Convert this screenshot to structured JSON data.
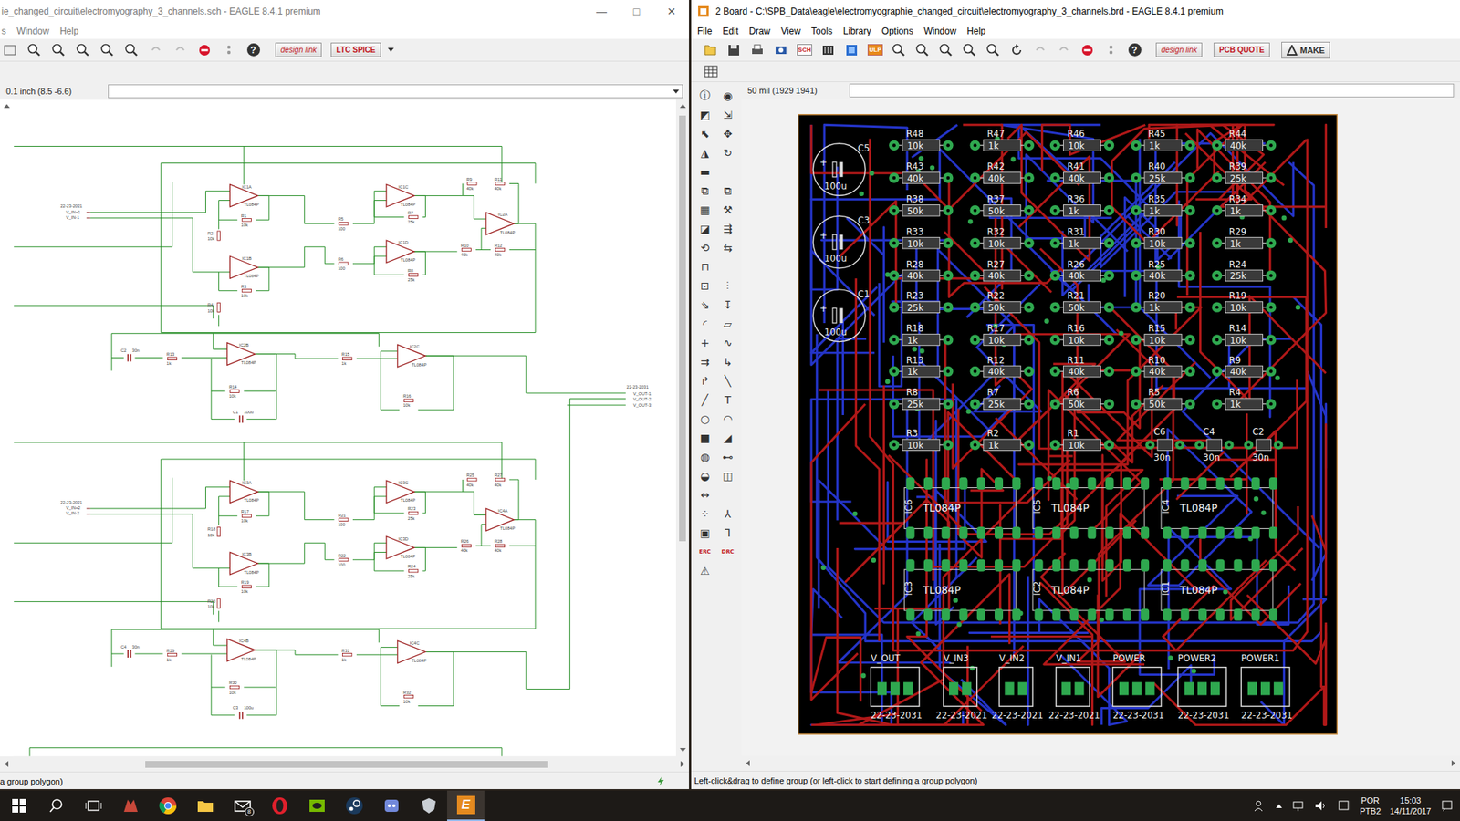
{
  "schematic_window": {
    "title": "ie_changed_circuit\\electromyography_3_channels.sch - EAGLE 8.4.1 premium",
    "controls": [
      "—",
      "□",
      "✕"
    ],
    "menu": [
      "s",
      "Window",
      "Help"
    ],
    "help_icon": "?",
    "badges": [
      "design link",
      "LTC SPICE"
    ],
    "coordinate": "0.1 inch (8.5 -6.6)",
    "status": "a group polygon)",
    "channels": [
      {
        "connector": "22-23-2021",
        "inputs": [
          "V_IN+1",
          "V_IN-1"
        ],
        "opamps": [
          {
            "name": "IC1A",
            "value": "TL084P"
          },
          {
            "name": "IC1C",
            "value": "TL084P"
          },
          {
            "name": "IC2A",
            "value": "TL084P"
          },
          {
            "name": "IC1B",
            "value": "TL084P"
          },
          {
            "name": "IC1D",
            "value": "TL084P"
          },
          {
            "name": "IC2B",
            "value": "TL084P"
          },
          {
            "name": "IC2C",
            "value": "TL084P"
          }
        ],
        "resistors": [
          {
            "name": "R1",
            "value": "10k"
          },
          {
            "name": "R2",
            "value": "10k"
          },
          {
            "name": "R3",
            "value": "10k"
          },
          {
            "name": "R4",
            "value": "10k"
          },
          {
            "name": "R5",
            "value": "100"
          },
          {
            "name": "R6",
            "value": "100"
          },
          {
            "name": "R7",
            "value": "25k"
          },
          {
            "name": "R8",
            "value": "25k"
          },
          {
            "name": "R9",
            "value": "40k"
          },
          {
            "name": "R10",
            "value": "40k"
          },
          {
            "name": "R11",
            "value": "40k"
          },
          {
            "name": "R12",
            "value": "40k"
          },
          {
            "name": "R13",
            "value": "1k"
          },
          {
            "name": "R14",
            "value": "10k"
          },
          {
            "name": "R15",
            "value": "1k"
          },
          {
            "name": "R16",
            "value": "10k"
          }
        ],
        "capacitors": [
          {
            "name": "C2",
            "value": "30n"
          },
          {
            "name": "C1",
            "value": "100u"
          }
        ]
      },
      {
        "connector": "22-23-2021",
        "inputs": [
          "V_IN+2",
          "V_IN-2"
        ],
        "opamps": [
          {
            "name": "IC3A",
            "value": "TL084P"
          },
          {
            "name": "IC3C",
            "value": "TL084P"
          },
          {
            "name": "IC4A",
            "value": "TL084P"
          },
          {
            "name": "IC3B",
            "value": "TL084P"
          },
          {
            "name": "IC3D",
            "value": "TL084P"
          },
          {
            "name": "IC4B",
            "value": "TL084P"
          },
          {
            "name": "IC4C",
            "value": "TL084P"
          }
        ],
        "resistors": [
          {
            "name": "R17",
            "value": "10k"
          },
          {
            "name": "R18",
            "value": "10k"
          },
          {
            "name": "R19",
            "value": "10k"
          },
          {
            "name": "R20",
            "value": "10k"
          },
          {
            "name": "R21",
            "value": "100"
          },
          {
            "name": "R22",
            "value": "100"
          },
          {
            "name": "R23",
            "value": "25k"
          },
          {
            "name": "R24",
            "value": "25k"
          },
          {
            "name": "R25",
            "value": "40k"
          },
          {
            "name": "R26",
            "value": "40k"
          },
          {
            "name": "R27",
            "value": "40k"
          },
          {
            "name": "R28",
            "value": "40k"
          },
          {
            "name": "R29",
            "value": "1k"
          },
          {
            "name": "R30",
            "value": "10k"
          },
          {
            "name": "R31",
            "value": "1k"
          },
          {
            "name": "R32",
            "value": "10k"
          }
        ],
        "capacitors": [
          {
            "name": "C4",
            "value": "30n"
          },
          {
            "name": "C3",
            "value": "100u"
          }
        ]
      }
    ],
    "output": {
      "part": "22-23-2031",
      "pins": [
        "V_OUT-1",
        "V_OUT-2",
        "V_OUT-3"
      ]
    }
  },
  "board_window": {
    "title": "2 Board - C:\\SPB_Data\\eagle\\electromyographie_changed_circuit\\electromyography_3_channels.brd - EAGLE 8.4.1 premium",
    "menu": [
      "File",
      "Edit",
      "Draw",
      "View",
      "Tools",
      "Library",
      "Options",
      "Window",
      "Help"
    ],
    "help_icon": "?",
    "icon_texts": [
      "SCH",
      "ULP"
    ],
    "badges": [
      "design link",
      "PCB QUOTE",
      "MAKE"
    ],
    "coordinate": "50 mil (1929 1941)",
    "status": "Left-click&drag to define group (or left-click to start defining a group polygon)",
    "tools": [
      [
        "ⓘ",
        "◉"
      ],
      [
        "◩",
        "⇲"
      ],
      [
        "⬉",
        "✥"
      ],
      [
        "◮",
        "↻"
      ],
      [
        "▬"
      ],
      [
        "⧉",
        "⧉"
      ],
      [
        "▦",
        "⚒"
      ],
      [
        "◪",
        "⇶"
      ],
      [
        "⟲",
        "⇆"
      ],
      [
        "⊓"
      ],
      [
        "⊡",
        "⫶"
      ],
      [
        "⇘",
        "↧"
      ],
      [
        "◜",
        "▱"
      ],
      [
        "+",
        "∿"
      ],
      [
        "⇉",
        "↳"
      ],
      [
        "↱",
        "╲"
      ],
      [
        "╱",
        "T"
      ],
      [
        "○",
        "◠"
      ],
      [
        "■",
        "◢"
      ],
      [
        "◍",
        "⊷"
      ],
      [
        "◒",
        "◫"
      ],
      [
        "↔"
      ],
      [
        "⁘",
        "⅄"
      ],
      [
        "▣",
        "⅂"
      ],
      [
        "ERC",
        "DRC"
      ],
      [
        "⚠"
      ]
    ],
    "resistor_rows": [
      [
        {
          "name": "R48",
          "value": "10k"
        },
        {
          "name": "R47",
          "value": "1k"
        },
        {
          "name": "R46",
          "value": "10k"
        },
        {
          "name": "R45",
          "value": "1k"
        },
        {
          "name": "R44",
          "value": "40k"
        }
      ],
      [
        {
          "name": "R43",
          "value": "40k"
        },
        {
          "name": "R42",
          "value": "40k"
        },
        {
          "name": "R41",
          "value": "40k"
        },
        {
          "name": "R40",
          "value": "25k"
        },
        {
          "name": "R39",
          "value": "25k"
        }
      ],
      [
        {
          "name": "R38",
          "value": "50k"
        },
        {
          "name": "R37",
          "value": "50k"
        },
        {
          "name": "R36",
          "value": "1k"
        },
        {
          "name": "R35",
          "value": "1k"
        },
        {
          "name": "R34",
          "value": "1k"
        }
      ],
      [
        {
          "name": "R33",
          "value": "10k"
        },
        {
          "name": "R32",
          "value": "10k"
        },
        {
          "name": "R31",
          "value": "1k"
        },
        {
          "name": "R30",
          "value": "10k"
        },
        {
          "name": "R29",
          "value": "1k"
        }
      ],
      [
        {
          "name": "R28",
          "value": "40k"
        },
        {
          "name": "R27",
          "value": "40k"
        },
        {
          "name": "R26",
          "value": "40k"
        },
        {
          "name": "R25",
          "value": "40k"
        },
        {
          "name": "R24",
          "value": "25k"
        }
      ],
      [
        {
          "name": "R23",
          "value": "25k"
        },
        {
          "name": "R22",
          "value": "50k"
        },
        {
          "name": "R21",
          "value": "50k"
        },
        {
          "name": "R20",
          "value": "1k"
        },
        {
          "name": "R19",
          "value": "10k"
        }
      ],
      [
        {
          "name": "R18",
          "value": "1k"
        },
        {
          "name": "R17",
          "value": "10k"
        },
        {
          "name": "R16",
          "value": "10k"
        },
        {
          "name": "R15",
          "value": "10k"
        },
        {
          "name": "R14",
          "value": "10k"
        }
      ],
      [
        {
          "name": "R13",
          "value": "1k"
        },
        {
          "name": "R12",
          "value": "40k"
        },
        {
          "name": "R11",
          "value": "40k"
        },
        {
          "name": "R10",
          "value": "40k"
        },
        {
          "name": "R9",
          "value": "40k"
        }
      ],
      [
        {
          "name": "R8",
          "value": "25k"
        },
        {
          "name": "R7",
          "value": "25k"
        },
        {
          "name": "R6",
          "value": "50k"
        },
        {
          "name": "R5",
          "value": "50k"
        },
        {
          "name": "R4",
          "value": "1k"
        }
      ],
      [
        {
          "name": "R3",
          "value": "10k"
        },
        {
          "name": "R2",
          "value": "1k"
        },
        {
          "name": "R1",
          "value": "10k"
        }
      ]
    ],
    "ceramic_caps": [
      {
        "name": "C6",
        "value": "30n"
      },
      {
        "name": "C4",
        "value": "30n"
      },
      {
        "name": "C2",
        "value": "30n"
      }
    ],
    "electrolytic_caps": [
      {
        "name": "C5",
        "value": "100u"
      },
      {
        "name": "C3",
        "value": "100u"
      },
      {
        "name": "C1",
        "value": "100u"
      }
    ],
    "ics": [
      {
        "name": "IC6",
        "value": "TL084P"
      },
      {
        "name": "IC5",
        "value": "TL084P"
      },
      {
        "name": "IC4",
        "value": "TL084P"
      },
      {
        "name": "IC3",
        "value": "TL084P"
      },
      {
        "name": "IC2",
        "value": "TL084P"
      },
      {
        "name": "IC1",
        "value": "TL084P"
      }
    ],
    "connectors": [
      {
        "name": "V_OUT",
        "part": "22-23-2031",
        "pins": 3
      },
      {
        "name": "V_IN3",
        "part": "22-23-2021",
        "pins": 2
      },
      {
        "name": "V_IN2",
        "part": "22-23-2021",
        "pins": 2
      },
      {
        "name": "V_IN1",
        "part": "22-23-2021",
        "pins": 2
      },
      {
        "name": "POWER",
        "part": "22-23-2031",
        "pins": 3
      },
      {
        "name": "POWER2",
        "part": "22-23-2031",
        "pins": 3
      },
      {
        "name": "POWER1",
        "part": "22-23-2031",
        "pins": 3
      }
    ]
  },
  "taskbar": {
    "mail_badge": "8",
    "eagle_glyph": "E",
    "language": "POR",
    "layout": "PTB2",
    "time": "15:03",
    "date": "14/11/2017"
  }
}
